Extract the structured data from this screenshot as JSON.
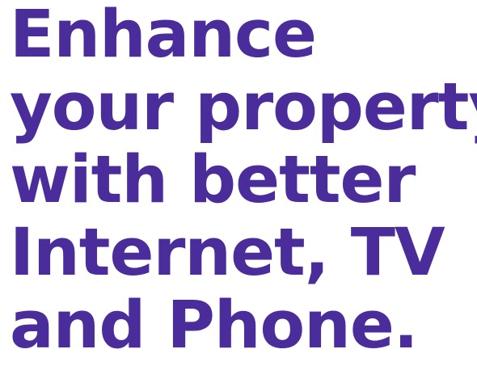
{
  "headline": {
    "lines": [
      "Enhance",
      "your property",
      "with better",
      "Internet, TV",
      "and Phone."
    ],
    "color": "#4a2c9a"
  }
}
